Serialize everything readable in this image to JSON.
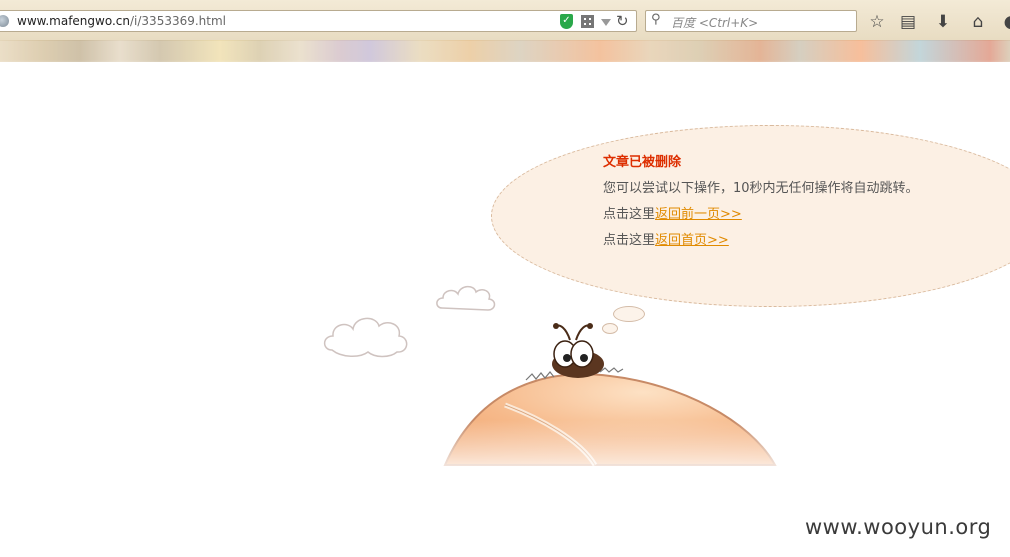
{
  "browser": {
    "url_host": "www.mafengwo.cn",
    "url_path": "/i/3353369.html",
    "search_placeholder": "百度 <Ctrl+K>"
  },
  "notice": {
    "title": "文章已被删除",
    "description": "您可以尝试以下操作，10秒内无任何操作将自动跳转。",
    "line1_prefix": "点击这里",
    "line1_link": "返回前一页>>",
    "line2_prefix": "点击这里",
    "line2_link": "返回首页>>"
  },
  "watermark": "www.wooyun.org",
  "colors": {
    "title": "#dd2e00",
    "link": "#e08a00",
    "bubble": "#fcf0e4"
  }
}
